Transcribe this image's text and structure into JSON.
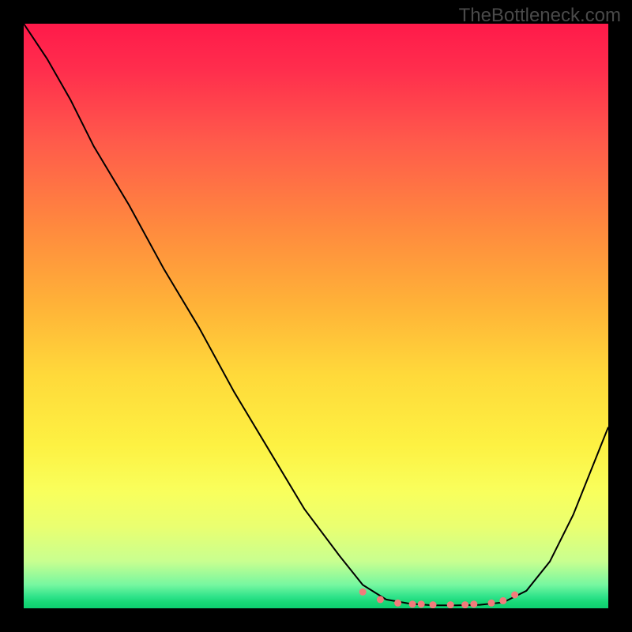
{
  "watermark": "TheBottleneck.com",
  "chart_data": {
    "type": "line",
    "title": "",
    "xlabel": "",
    "ylabel": "",
    "xlim": [
      0,
      100
    ],
    "ylim": [
      0,
      100
    ],
    "grid": false,
    "legend": false,
    "background": "rainbow-gradient-vertical-red-to-green",
    "x": [
      0,
      4,
      8,
      12,
      18,
      24,
      30,
      36,
      42,
      48,
      54,
      58,
      62,
      66,
      70,
      74,
      78,
      82,
      86,
      90,
      94,
      98,
      100
    ],
    "values": [
      100,
      94,
      87,
      79,
      69,
      58,
      48,
      37,
      27,
      17,
      9,
      4,
      1.5,
      0.8,
      0.5,
      0.5,
      0.6,
      1,
      3,
      8,
      16,
      26,
      31
    ],
    "scatter_points": {
      "x": [
        58,
        61,
        64,
        66.5,
        68,
        70,
        73,
        75.5,
        77,
        80,
        82,
        84
      ],
      "y": [
        2.8,
        1.5,
        0.9,
        0.7,
        0.7,
        0.6,
        0.6,
        0.6,
        0.7,
        0.9,
        1.3,
        2.3
      ],
      "color": "#f27b7b",
      "radius": 4.5
    },
    "line_color": "#000000",
    "line_width": 2
  }
}
